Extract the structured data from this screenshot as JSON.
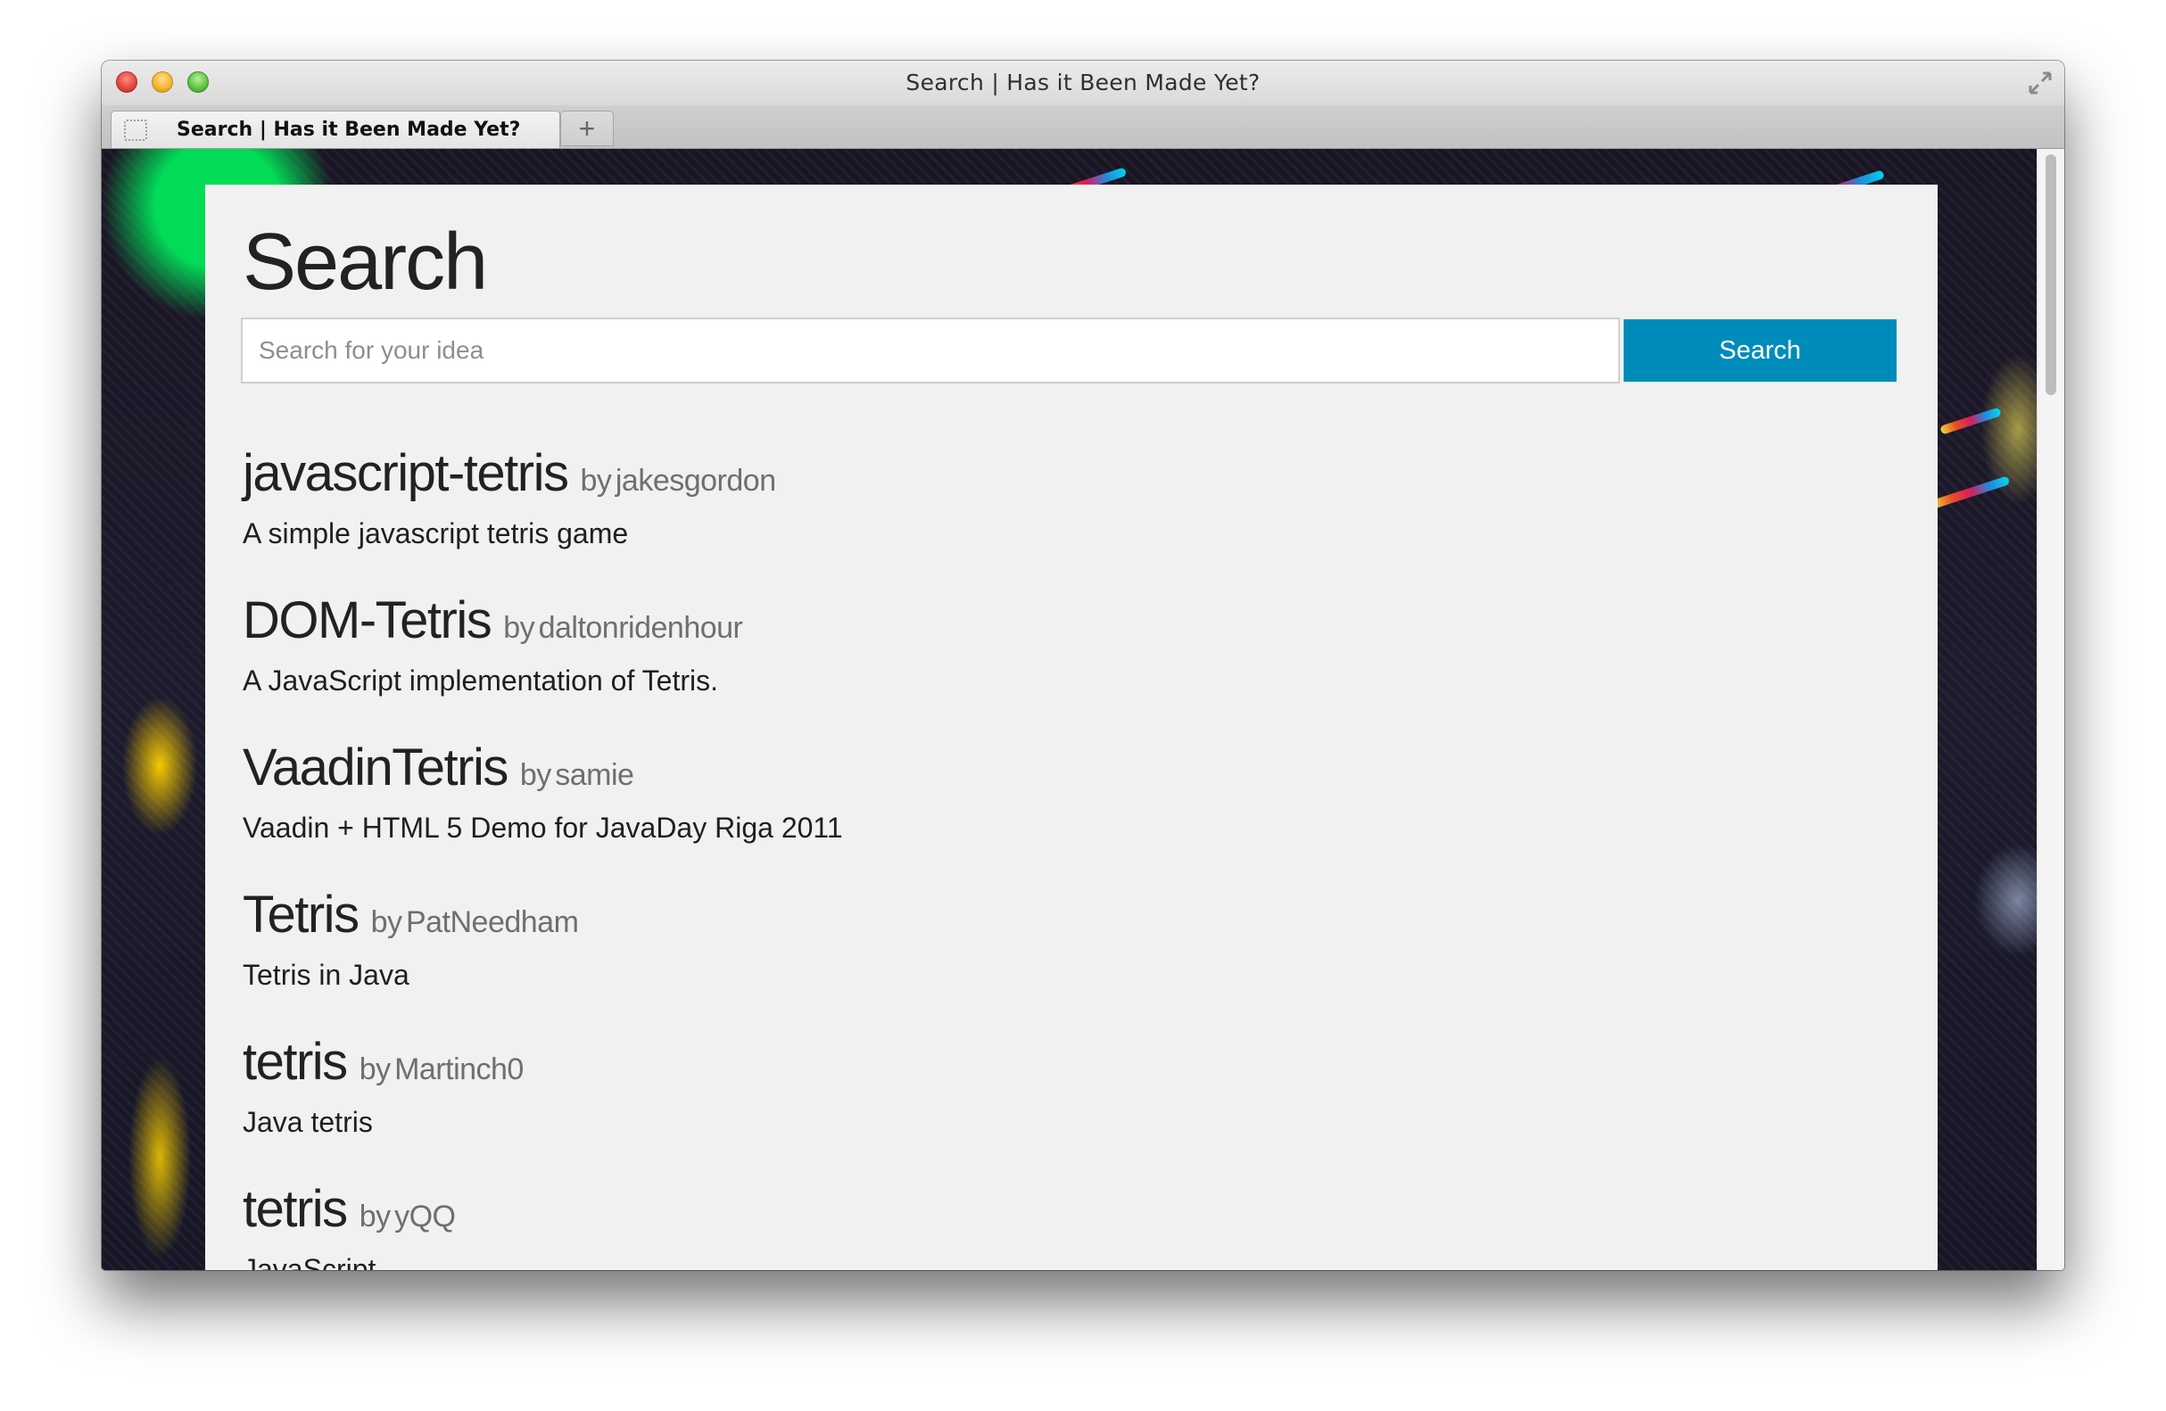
{
  "window": {
    "title": "Search | Has it Been Made Yet?",
    "tab_title": "Search | Has it Been Made Yet?",
    "new_tab_label": "+"
  },
  "page": {
    "heading": "Search",
    "search": {
      "placeholder": "Search for your idea",
      "value": "",
      "button_label": "Search"
    },
    "by_label": "by",
    "results": [
      {
        "name": "javascript-tetris",
        "author": "jakesgordon",
        "description": "A simple javascript tetris game"
      },
      {
        "name": "DOM-Tetris",
        "author": "daltonridenhour",
        "description": "A JavaScript implementation of Tetris."
      },
      {
        "name": "VaadinTetris",
        "author": "samie",
        "description": "Vaadin + HTML 5 Demo for JavaDay Riga 2011"
      },
      {
        "name": "Tetris",
        "author": "PatNeedham",
        "description": "Tetris in Java"
      },
      {
        "name": "tetris",
        "author": "Martinch0",
        "description": "Java tetris"
      },
      {
        "name": "tetris",
        "author": "yQQ",
        "description": "JavaScript"
      }
    ]
  },
  "colors": {
    "button": "#008cba",
    "content_background": "#f1f1f1",
    "text": "#222222",
    "muted_text": "#6f6f6f"
  },
  "icons": {
    "close": "close-button",
    "minimize": "minimize-button",
    "zoom": "zoom-button",
    "fullscreen": "fullscreen-icon",
    "favicon": "blank-page-icon"
  }
}
